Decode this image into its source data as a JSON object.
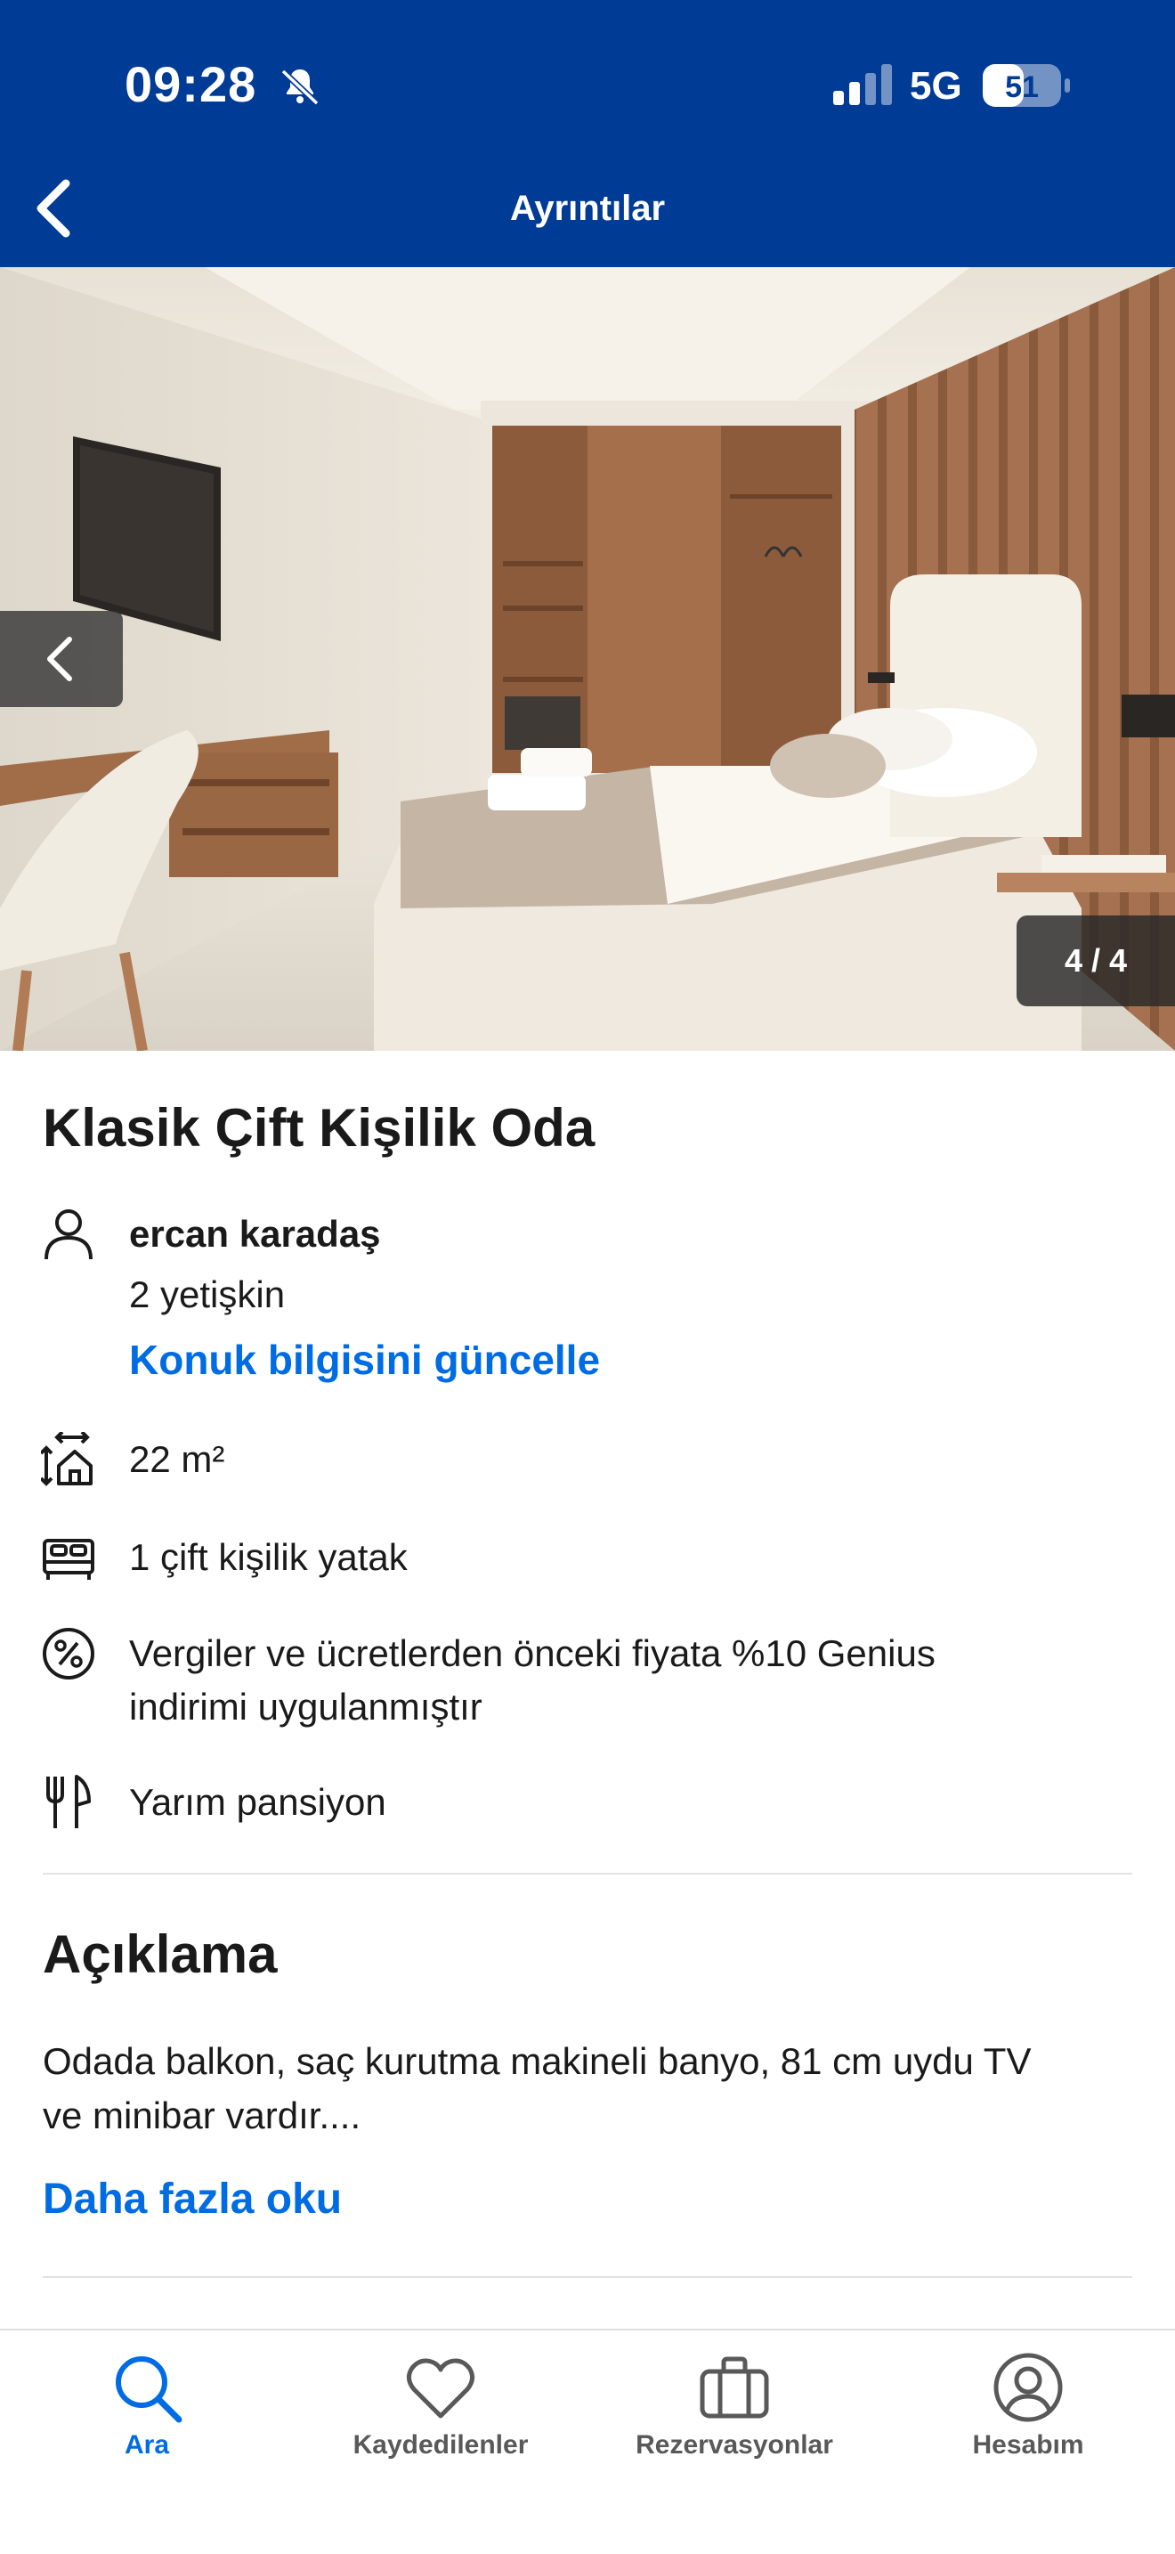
{
  "status_bar": {
    "time": "09:28",
    "network": "5G",
    "battery": "51",
    "icons": [
      "bell-muted-icon",
      "signal-icon",
      "battery-icon"
    ]
  },
  "header": {
    "title": "Ayrıntılar",
    "back_icon": "chevron-left-icon"
  },
  "gallery": {
    "counter": "4 / 4",
    "prev_icon": "chevron-left-icon"
  },
  "room": {
    "title": "Klasik Çift Kişilik Oda",
    "guest_name": "ercan karadaş",
    "guest_count": "2 yetişkin",
    "update_guest_link": "Konuk bilgisini güncelle",
    "size": "22 m²",
    "bed": "1 çift kişilik yatak",
    "discount_line1": "Vergiler ve ücretlerden önceki fiyata %10 Genius",
    "discount_line2": "indirimi uygulanmıştır",
    "meal": "Yarım pansiyon"
  },
  "description": {
    "title": "Açıklama",
    "text_line1": "Odada balkon, saç kurutma makineli banyo, 81 cm uydu TV",
    "text_line2": "ve minibar vardır....",
    "read_more": "Daha fazla oku"
  },
  "tabs": [
    {
      "label": "Ara",
      "icon": "search-icon",
      "active": true
    },
    {
      "label": "Kaydedilenler",
      "icon": "heart-icon",
      "active": false
    },
    {
      "label": "Rezervasyonlar",
      "icon": "briefcase-icon",
      "active": false
    },
    {
      "label": "Hesabım",
      "icon": "account-icon",
      "active": false
    }
  ],
  "colors": {
    "brand_blue": "#003b95",
    "link_blue": "#006ce4",
    "text": "#1a1a1a"
  }
}
